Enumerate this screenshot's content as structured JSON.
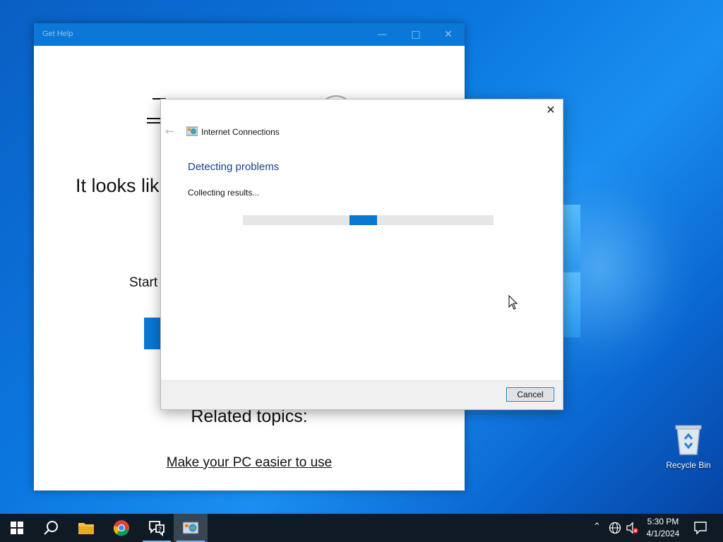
{
  "get_help": {
    "title": "Get Help",
    "headline": "It looks lik",
    "start_text": "Start",
    "related_title": "Related topics:",
    "related_link": "Make your PC easier to use"
  },
  "dialog": {
    "app_title": "Internet Connections",
    "heading": "Detecting problems",
    "status": "Collecting results...",
    "cancel_label": "Cancel",
    "progress_style": "indeterminate"
  },
  "desktop": {
    "recycle_bin_label": "Recycle Bin"
  },
  "taskbar": {
    "time": "5:30 PM",
    "date": "4/1/2024",
    "pinned": [
      "start-icon",
      "search-icon",
      "file-explorer-icon",
      "chrome-icon",
      "get-help-icon",
      "internet-connections-troubleshooter-icon"
    ],
    "tray": [
      "chevron-up-icon",
      "network-globe-icon",
      "volume-muted-icon",
      "notification-icon"
    ]
  },
  "colors": {
    "accent": "#0078d7",
    "heading_blue": "#1a3f8c",
    "taskbar": "#101a24"
  }
}
